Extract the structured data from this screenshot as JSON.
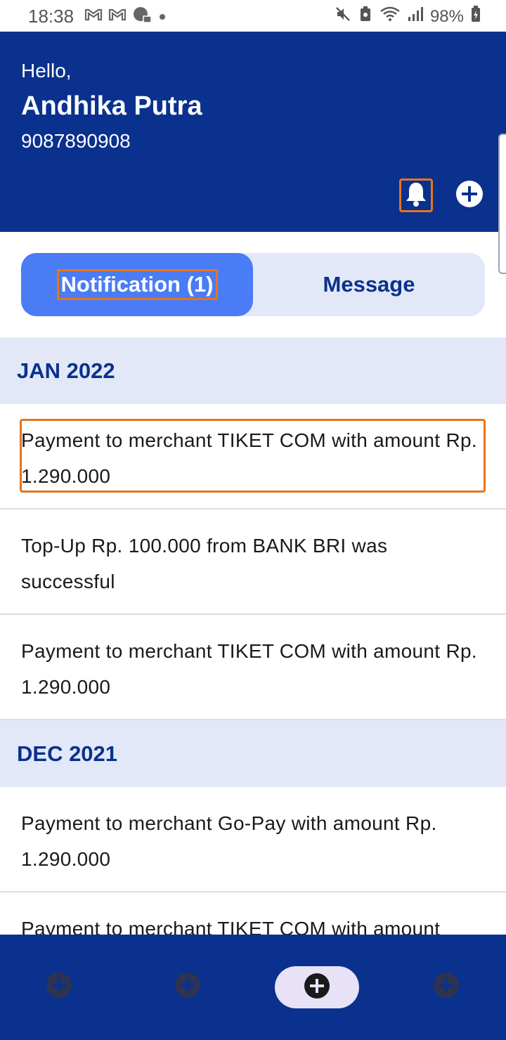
{
  "status_bar": {
    "time": "18:38",
    "left_icons": [
      "gmail-icon",
      "gmail-icon",
      "messenger-icon",
      "dot-icon"
    ],
    "right_icons": [
      "mute-icon",
      "battery-saver-icon",
      "wifi-icon",
      "signal-icon"
    ],
    "battery": "98%"
  },
  "header": {
    "greeting": "Hello,",
    "name": "Andhika Putra",
    "phone": "9087890908"
  },
  "tabs": [
    {
      "label": "Notification (1)",
      "active": true
    },
    {
      "label": "Message",
      "active": false
    }
  ],
  "sections": [
    {
      "title": "JAN 2022",
      "items": [
        "Payment to merchant TIKET COM with amount Rp. 1.290.000",
        "Top-Up Rp. 100.000 from BANK BRI was successful",
        "Payment to merchant TIKET COM with amount Rp. 1.290.000"
      ]
    },
    {
      "title": "DEC 2021",
      "items": [
        "Payment to merchant Go-Pay with amount Rp. 1.290.000",
        "Payment to merchant TIKET COM with amount"
      ]
    }
  ],
  "colors": {
    "primary": "#0a318d",
    "accent": "#4a7cf6",
    "tab_bg": "#e2e8f7",
    "highlight": "#e8741a"
  }
}
